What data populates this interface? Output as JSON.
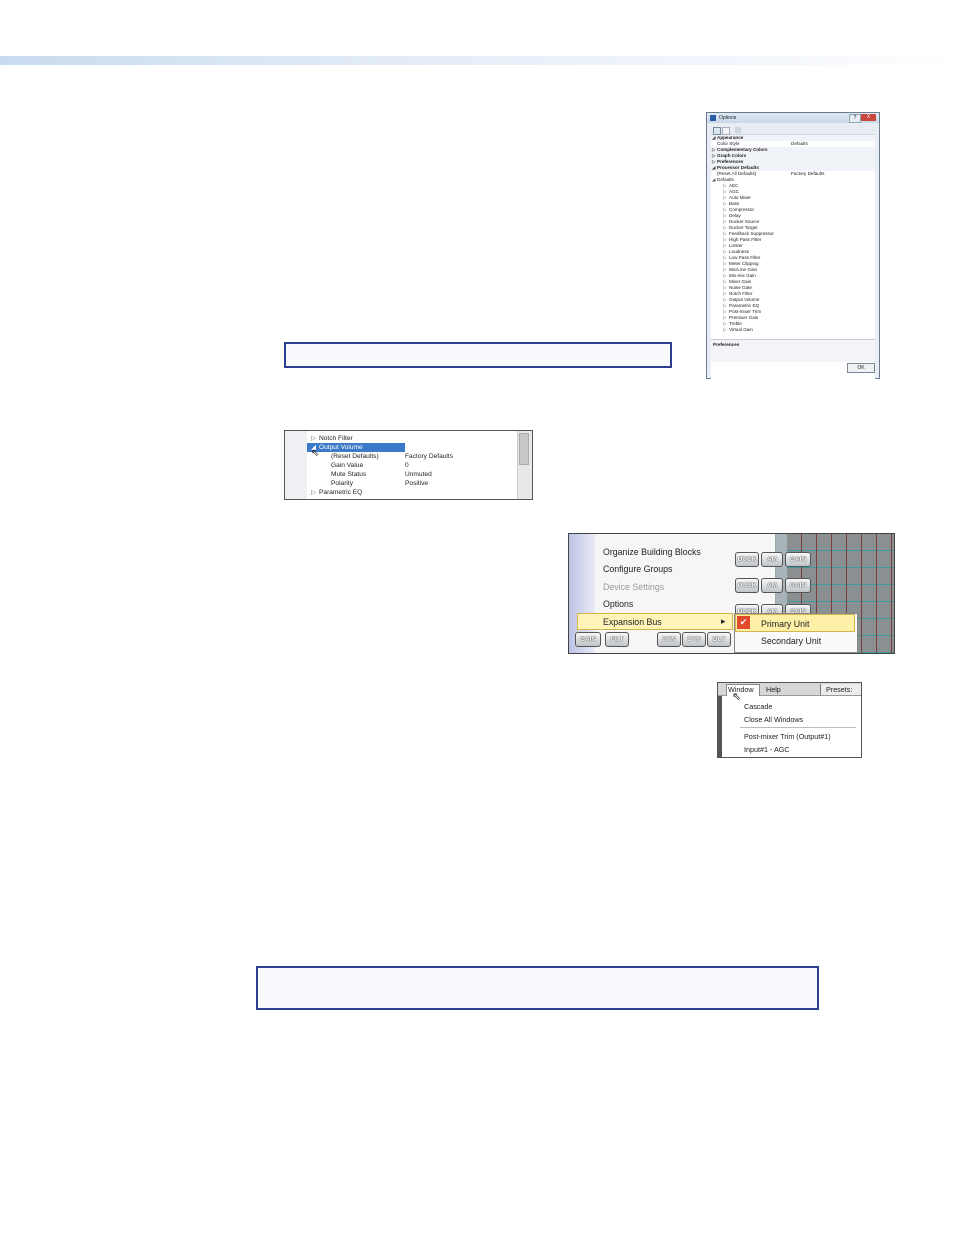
{
  "options_dialog": {
    "title": "Options",
    "help_btn": "?",
    "close_btn": "X",
    "ok_btn": "OK",
    "description": "Preferences",
    "rows": [
      {
        "label": "Appearance",
        "value": "",
        "kind": "cat",
        "arrow": "◢"
      },
      {
        "label": "Color Style",
        "value": "Defaults",
        "kind": "prop",
        "arrow": ""
      },
      {
        "label": "Complementary Colors",
        "value": "",
        "kind": "cat",
        "arrow": "▷"
      },
      {
        "label": "Graph Colors",
        "value": "",
        "kind": "cat",
        "arrow": "▷"
      },
      {
        "label": "Preferences",
        "value": "",
        "kind": "cat",
        "arrow": "▷"
      },
      {
        "label": "Processor Defaults",
        "value": "",
        "kind": "cat",
        "arrow": "◢"
      },
      {
        "label": "(Reset All Defaults)",
        "value": "Factory Defaults",
        "kind": "prop",
        "arrow": ""
      },
      {
        "label": "Defaults",
        "value": "",
        "kind": "prop",
        "arrow": "◢"
      },
      {
        "label": "AEC",
        "value": "",
        "kind": "child",
        "arrow": "▷"
      },
      {
        "label": "AGC",
        "value": "",
        "kind": "child",
        "arrow": "▷"
      },
      {
        "label": "Auto Mixer",
        "value": "",
        "kind": "child",
        "arrow": "▷"
      },
      {
        "label": "Bass",
        "value": "",
        "kind": "child",
        "arrow": "▷"
      },
      {
        "label": "Compressor",
        "value": "",
        "kind": "child",
        "arrow": "▷"
      },
      {
        "label": "Delay",
        "value": "",
        "kind": "child",
        "arrow": "▷"
      },
      {
        "label": "Ducker Source",
        "value": "",
        "kind": "child",
        "arrow": "▷"
      },
      {
        "label": "Ducker Target",
        "value": "",
        "kind": "child",
        "arrow": "▷"
      },
      {
        "label": "Feedback Suppressor",
        "value": "",
        "kind": "child",
        "arrow": "▷"
      },
      {
        "label": "High Pass Filter",
        "value": "",
        "kind": "child",
        "arrow": "▷"
      },
      {
        "label": "Limiter",
        "value": "",
        "kind": "child",
        "arrow": "▷"
      },
      {
        "label": "Loudness",
        "value": "",
        "kind": "child",
        "arrow": "▷"
      },
      {
        "label": "Low Pass Filter",
        "value": "",
        "kind": "child",
        "arrow": "▷"
      },
      {
        "label": "Meter Clipping",
        "value": "",
        "kind": "child",
        "arrow": "▷"
      },
      {
        "label": "Mic/Line Gain",
        "value": "",
        "kind": "child",
        "arrow": "▷"
      },
      {
        "label": "Mix-mix Gain",
        "value": "",
        "kind": "child",
        "arrow": "▷"
      },
      {
        "label": "Mixer Gain",
        "value": "",
        "kind": "child",
        "arrow": "▷"
      },
      {
        "label": "Noise Gate",
        "value": "",
        "kind": "child",
        "arrow": "▷"
      },
      {
        "label": "Notch Filter",
        "value": "",
        "kind": "child",
        "arrow": "▷"
      },
      {
        "label": "Output Volume",
        "value": "",
        "kind": "child",
        "arrow": "▷"
      },
      {
        "label": "Parametric EQ",
        "value": "",
        "kind": "child",
        "arrow": "▷"
      },
      {
        "label": "Post-mixer Trim",
        "value": "",
        "kind": "child",
        "arrow": "▷"
      },
      {
        "label": "Premixer Gain",
        "value": "",
        "kind": "child",
        "arrow": "▷"
      },
      {
        "label": "Treble",
        "value": "",
        "kind": "child",
        "arrow": "▷"
      },
      {
        "label": "Virtual Gain",
        "value": "",
        "kind": "child",
        "arrow": "▷"
      }
    ]
  },
  "property_grid": {
    "rows": [
      {
        "label": "Notch Filter",
        "value": "",
        "indent": "node",
        "selected": false,
        "arrow": "▷"
      },
      {
        "label": "Output Volume",
        "value": "",
        "indent": "node",
        "selected": true,
        "arrow": "◢"
      },
      {
        "label": "(Reset Defaults)",
        "value": "Factory Defaults",
        "indent": "prop",
        "selected": false,
        "arrow": ""
      },
      {
        "label": "Gain Value",
        "value": "0",
        "indent": "prop",
        "selected": false,
        "arrow": ""
      },
      {
        "label": "Mute Status",
        "value": "Unmuted",
        "indent": "prop",
        "selected": false,
        "arrow": ""
      },
      {
        "label": "Polarity",
        "value": "Positive",
        "indent": "prop",
        "selected": false,
        "arrow": ""
      },
      {
        "label": "Parametric EQ",
        "value": "",
        "indent": "node",
        "selected": false,
        "arrow": "▷"
      }
    ]
  },
  "context_menu": {
    "items": [
      {
        "label": "Organize Building Blocks",
        "disabled": false
      },
      {
        "label": "Configure Groups",
        "disabled": false
      },
      {
        "label": "Device Settings",
        "disabled": true
      },
      {
        "label": "Options",
        "disabled": false
      },
      {
        "label": "Expansion Bus",
        "disabled": false
      }
    ],
    "submenu_arrow": "▸",
    "submenu": [
      {
        "label": "Primary Unit",
        "checked": true
      },
      {
        "label": "Secondary Unit",
        "checked": false
      }
    ],
    "check_glyph": "✔",
    "blocks": {
      "duck": "DUCK",
      "am": "AM",
      "gain": "GAIN",
      "filt": "FILT",
      "dyn": "DYN",
      "dly": "DLY"
    }
  },
  "window_menu": {
    "menubar": [
      "Window",
      "Help"
    ],
    "presets": "Presets:",
    "items": [
      "Cascade",
      "Close All Windows",
      "Post-mixer Trim (Output#1)",
      "Input#1 - AGC"
    ]
  }
}
